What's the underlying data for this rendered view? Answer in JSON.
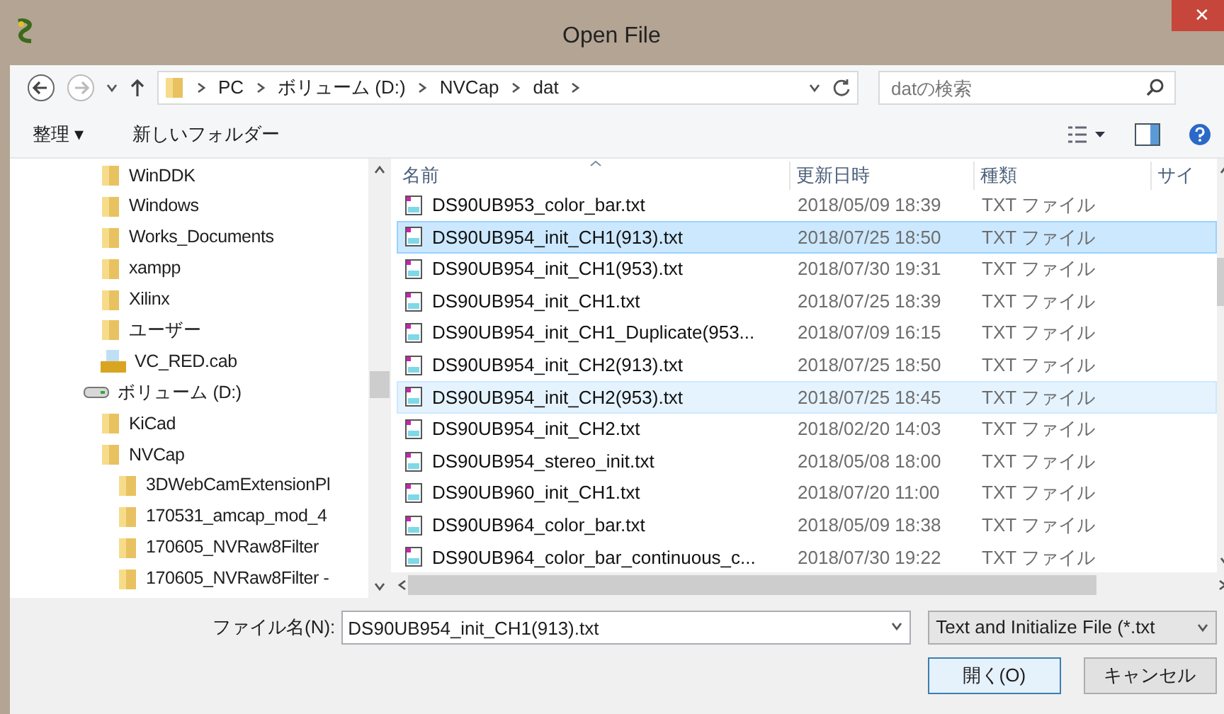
{
  "window": {
    "title": "Open File",
    "close": "✕"
  },
  "address": {
    "crumbs": [
      "PC",
      "ボリューム (D:)",
      "NVCap",
      "dat"
    ]
  },
  "search": {
    "placeholder": "datの検索"
  },
  "toolbar": {
    "organize": "整理 ▾",
    "new_folder": "新しいフォルダー"
  },
  "tree": [
    {
      "label": "WinDDK",
      "kind": "folder"
    },
    {
      "label": "Windows",
      "kind": "folder"
    },
    {
      "label": "Works_Documents",
      "kind": "folder"
    },
    {
      "label": "xampp",
      "kind": "folder"
    },
    {
      "label": "Xilinx",
      "kind": "folder"
    },
    {
      "label": "ユーザー",
      "kind": "folder"
    },
    {
      "label": "VC_RED.cab",
      "kind": "cab"
    },
    {
      "label": "ボリューム (D:)",
      "kind": "drive",
      "children": [
        {
          "label": "KiCad",
          "kind": "folder"
        },
        {
          "label": "NVCap",
          "kind": "folder",
          "children": [
            {
              "label": "3DWebCamExtensionPl",
              "kind": "folder"
            },
            {
              "label": "170531_amcap_mod_4",
              "kind": "folder"
            },
            {
              "label": "170605_NVRaw8Filter",
              "kind": "folder"
            },
            {
              "label": "170605_NVRaw8Filter -",
              "kind": "folder"
            }
          ]
        }
      ]
    }
  ],
  "table": {
    "columns": [
      "名前",
      "更新日時",
      "種類",
      "サイ"
    ],
    "rows": [
      {
        "name": "DS90UB953_color_bar.txt",
        "date": "2018/05/09 18:39",
        "type": "TXT ファイル",
        "selected": false,
        "hovered": false
      },
      {
        "name": "DS90UB954_init_CH1(913).txt",
        "date": "2018/07/25 18:50",
        "type": "TXT ファイル",
        "selected": true,
        "hovered": false
      },
      {
        "name": "DS90UB954_init_CH1(953).txt",
        "date": "2018/07/30 19:31",
        "type": "TXT ファイル",
        "selected": false,
        "hovered": false
      },
      {
        "name": "DS90UB954_init_CH1.txt",
        "date": "2018/07/25 18:39",
        "type": "TXT ファイル",
        "selected": false,
        "hovered": false
      },
      {
        "name": "DS90UB954_init_CH1_Duplicate(953...",
        "date": "2018/07/09 16:15",
        "type": "TXT ファイル",
        "selected": false,
        "hovered": false
      },
      {
        "name": "DS90UB954_init_CH2(913).txt",
        "date": "2018/07/25 18:50",
        "type": "TXT ファイル",
        "selected": false,
        "hovered": false
      },
      {
        "name": "DS90UB954_init_CH2(953).txt",
        "date": "2018/07/25 18:45",
        "type": "TXT ファイル",
        "selected": false,
        "hovered": true
      },
      {
        "name": "DS90UB954_init_CH2.txt",
        "date": "2018/02/20 14:03",
        "type": "TXT ファイル",
        "selected": false,
        "hovered": false
      },
      {
        "name": "DS90UB954_stereo_init.txt",
        "date": "2018/05/08 18:00",
        "type": "TXT ファイル",
        "selected": false,
        "hovered": false
      },
      {
        "name": "DS90UB960_init_CH1.txt",
        "date": "2018/07/20 11:00",
        "type": "TXT ファイル",
        "selected": false,
        "hovered": false
      },
      {
        "name": "DS90UB964_color_bar.txt",
        "date": "2018/05/09 18:38",
        "type": "TXT ファイル",
        "selected": false,
        "hovered": false
      },
      {
        "name": "DS90UB964_color_bar_continuous_c...",
        "date": "2018/07/30 19:22",
        "type": "TXT ファイル",
        "selected": false,
        "hovered": false
      }
    ]
  },
  "footer": {
    "filename_label": "ファイル名(N):",
    "filename": "DS90UB954_init_CH1(913).txt",
    "filter": "Text and Initialize File (*.txt",
    "open": "開く(O)",
    "cancel": "キャンセル"
  }
}
